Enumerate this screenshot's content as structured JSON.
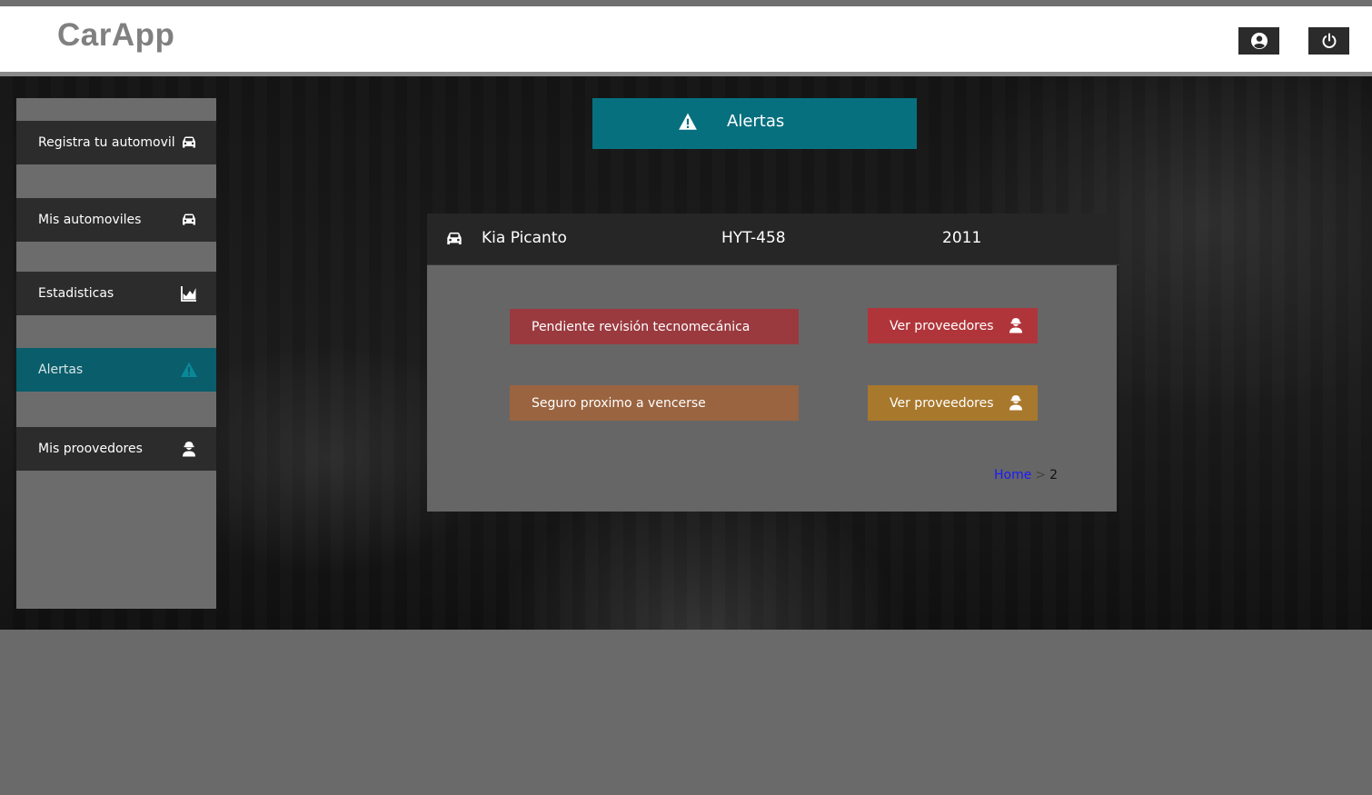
{
  "header": {
    "logo": "CarApp"
  },
  "sidebar": {
    "items": [
      {
        "label": "Registra tu automovil",
        "icon": "car-icon"
      },
      {
        "label": "Mis automoviles",
        "icon": "car-icon"
      },
      {
        "label": "Estadisticas",
        "icon": "area-chart-icon"
      },
      {
        "label": "Alertas",
        "icon": "warning-icon",
        "active": true
      },
      {
        "label": "Mis proovedores",
        "icon": "worker-icon"
      }
    ]
  },
  "banner": {
    "label": "Alertas",
    "icon": "warning-icon"
  },
  "car": {
    "name": "Kia Picanto",
    "plate": "HYT-458",
    "year": "2011"
  },
  "alerts": [
    {
      "text": "Pendiente revisión tecnomecánica",
      "action": "Ver proveedores",
      "color": "#9a3a3f",
      "button_color": "#b0353a"
    },
    {
      "text": "Seguro proximo a vencerse",
      "action": "Ver proveedores",
      "color": "#9a6440",
      "button_color": "#a8782c"
    }
  ],
  "breadcrumb": {
    "home": "Home",
    "separator": ">",
    "current": "2"
  },
  "colors": {
    "accent": "#07707f",
    "active_sidebar": "#0a5d6a"
  }
}
